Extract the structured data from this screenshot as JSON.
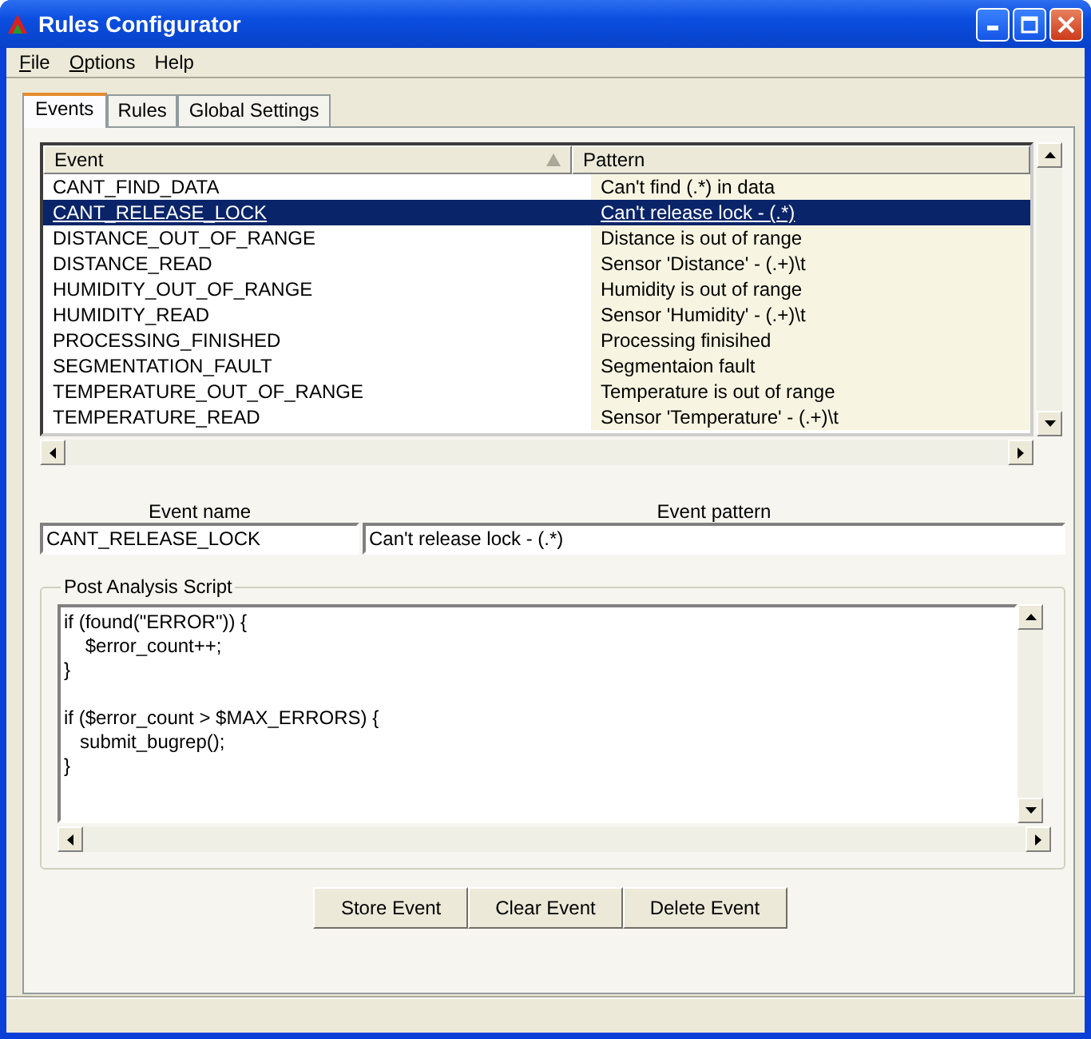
{
  "window": {
    "title": "Rules Configurator"
  },
  "menu": [
    {
      "label": "File",
      "mnemonic": true
    },
    {
      "label": "Options",
      "mnemonic": true
    },
    {
      "label": "Help",
      "mnemonic": false
    }
  ],
  "tabs": [
    {
      "label": "Events",
      "selected": true
    },
    {
      "label": "Rules",
      "selected": false
    },
    {
      "label": "Global Settings",
      "selected": false
    }
  ],
  "table": {
    "columns": [
      {
        "label": "Event",
        "sorted": true
      },
      {
        "label": "Pattern",
        "sorted": false
      }
    ],
    "rows": [
      {
        "event": "CANT_FIND_DATA",
        "pattern": "Can't find (.*) in data",
        "selected": false
      },
      {
        "event": "CANT_RELEASE_LOCK",
        "pattern": "Can't release lock - (.*)",
        "selected": true
      },
      {
        "event": "DISTANCE_OUT_OF_RANGE",
        "pattern": "Distance is out of range",
        "selected": false
      },
      {
        "event": "DISTANCE_READ",
        "pattern": "Sensor 'Distance' - (.+)\\t",
        "selected": false
      },
      {
        "event": "HUMIDITY_OUT_OF_RANGE",
        "pattern": "Humidity is out of range",
        "selected": false
      },
      {
        "event": "HUMIDITY_READ",
        "pattern": "Sensor 'Humidity' - (.+)\\t",
        "selected": false
      },
      {
        "event": "PROCESSING_FINISHED",
        "pattern": "Processing finisihed",
        "selected": false
      },
      {
        "event": "SEGMENTATION_FAULT",
        "pattern": "Segmentaion fault",
        "selected": false
      },
      {
        "event": "TEMPERATURE_OUT_OF_RANGE",
        "pattern": "Temperature is out of range",
        "selected": false
      },
      {
        "event": "TEMPERATURE_READ",
        "pattern": "Sensor 'Temperature' - (.+)\\t",
        "selected": false
      }
    ]
  },
  "event_name": {
    "label": "Event name",
    "value": "CANT_RELEASE_LOCK"
  },
  "event_pattern": {
    "label": "Event pattern",
    "value": "Can't release lock - (.*)"
  },
  "script": {
    "label": "Post Analysis Script",
    "value": "if (found(\"ERROR\")) {\n    $error_count++;\n}\n\nif ($error_count > $MAX_ERRORS) {\n   submit_bugrep();\n}"
  },
  "buttons": [
    "Store Event",
    "Clear Event",
    "Delete Event"
  ]
}
